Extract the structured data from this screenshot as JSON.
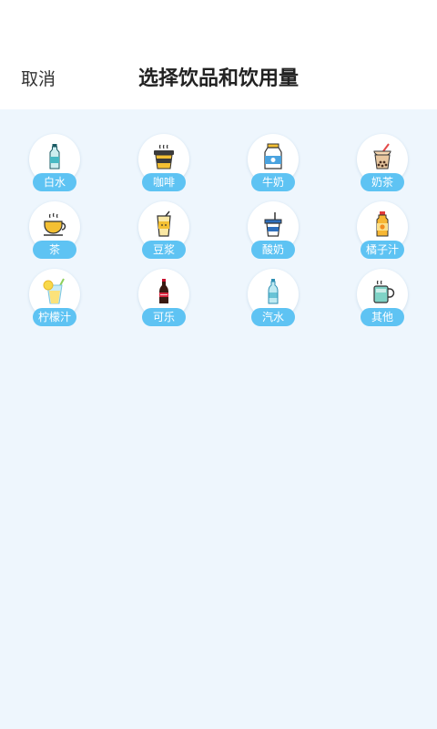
{
  "header": {
    "cancel_label": "取消",
    "title": "选择饮品和饮用量"
  },
  "drinks": [
    {
      "label": "白水",
      "icon": "water-bottle-icon"
    },
    {
      "label": "咖啡",
      "icon": "coffee-cup-icon"
    },
    {
      "label": "牛奶",
      "icon": "milk-carton-icon"
    },
    {
      "label": "奶茶",
      "icon": "bubble-tea-icon"
    },
    {
      "label": "茶",
      "icon": "tea-cup-icon"
    },
    {
      "label": "豆浆",
      "icon": "soy-milk-cup-icon"
    },
    {
      "label": "酸奶",
      "icon": "yogurt-cup-icon"
    },
    {
      "label": "橘子汁",
      "icon": "orange-juice-bottle-icon"
    },
    {
      "label": "柠檬汁",
      "icon": "lemonade-glass-icon"
    },
    {
      "label": "可乐",
      "icon": "cola-bottle-icon"
    },
    {
      "label": "汽水",
      "icon": "soda-bottle-icon"
    },
    {
      "label": "其他",
      "icon": "mug-icon"
    }
  ],
  "colors": {
    "accent": "#5ec3f3",
    "content_background": "#eef6fd"
  }
}
